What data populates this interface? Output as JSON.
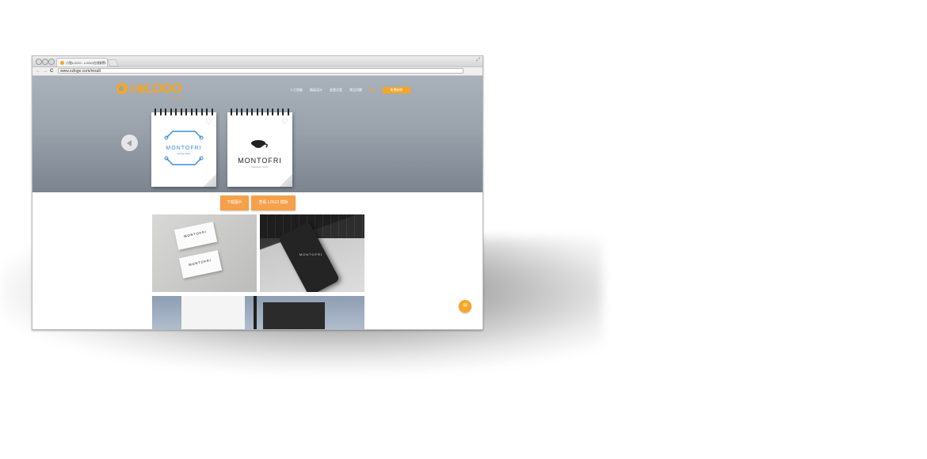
{
  "browser": {
    "tab_title": "小智LOGO - LOGO在线制作",
    "tab_close": "×",
    "url": "www.xzlogo.com/result",
    "back": "←",
    "forward": "→",
    "reload": "C"
  },
  "site": {
    "logo_cn": "小智",
    "logo_en": "LOGO",
    "logo_sub": "xzlogo.com",
    "nav": [
      "人工智能",
      "精英设计",
      "经营方案",
      "常见问题",
      "登录"
    ],
    "cta": "免费制作"
  },
  "carousel": {
    "cards": [
      {
        "name": "MONTOFRI",
        "tagline": "service office",
        "color": "#3a8fd6",
        "style": "blue-frame"
      },
      {
        "name": "MONTOFRI",
        "tagline": "DESIGN YOUR",
        "color": "#222222",
        "style": "cup"
      }
    ]
  },
  "actions": {
    "primary": "下载图片",
    "secondary": "查看 LOGO 模板"
  },
  "gallery": {
    "card_text": "MONTOFRI",
    "phone_text": "MONTOFRI"
  },
  "colors": {
    "accent": "#f5a623",
    "hero_top": "#a9b1ba",
    "hero_bottom": "#7b848f"
  },
  "icons": {
    "chat": "chat-icon",
    "prev": "chevron-left-icon",
    "heart": "heart-icon"
  }
}
